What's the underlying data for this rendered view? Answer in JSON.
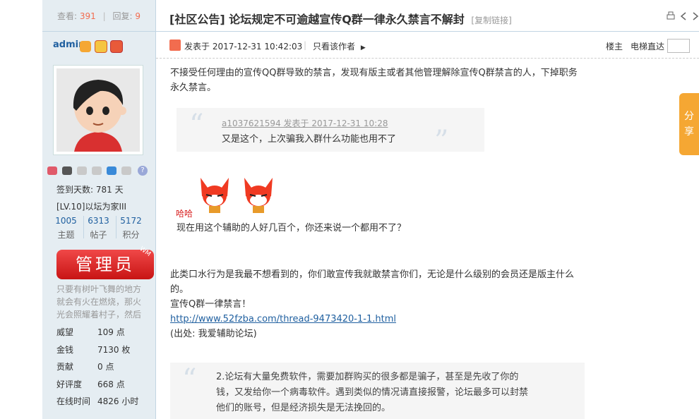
{
  "stats": {
    "views_label": "查看:",
    "views": "391",
    "replies_label": "回复:",
    "replies": "9"
  },
  "title": {
    "text": "[社区公告] 论坛规定不可逾越宣传Q群一律永久禁言不解封",
    "copy_link": "[复制链接]"
  },
  "author": {
    "username": "admin",
    "signin_days": "签到天数: 781 天",
    "level": "[LV.10]以坛为家III",
    "stats": [
      {
        "value": "1005",
        "label": "主题"
      },
      {
        "value": "6313",
        "label": "帖子"
      },
      {
        "value": "5172",
        "label": "积分"
      }
    ],
    "badge": "管理员",
    "badge_corner": "WM",
    "bio": "只要有树叶飞舞的地方就会有火在燃烧，那火光会照耀着村子，然后",
    "details": [
      {
        "label": "威望",
        "value": "109 点"
      },
      {
        "label": "金钱",
        "value": "7130 枚"
      },
      {
        "label": "贡献",
        "value": "0 点"
      },
      {
        "label": "好评度",
        "value": "668 点"
      },
      {
        "label": "在线时间",
        "value": "4826 小时"
      }
    ]
  },
  "meta": {
    "posted": "发表于 2017-12-31 10:42:03",
    "only_author": "只看该作者",
    "floor": "楼主",
    "jump": "电梯直达"
  },
  "post": {
    "intro": "不接受任何理由的宣传QQ群导致的禁言，发现有版主或者其他管理解除宣传Q群禁言的人，下掉职务永久禁言。",
    "quote1_author": "a1037621594 发表于 2017-12-31 10:28",
    "quote1_text": "又是这个，上次骗我入群什么功能也用不了",
    "emoji_label": "哈哈",
    "reply_text": "现在用这个辅助的人好几百个，你还来说一个都用不了？",
    "para2": "此类口水行为是我最不想看到的，你们敢宣传我就敢禁言你们，无论是什么级别的会员还是版主什么的。",
    "para3": "宣传Q群一律禁言！",
    "link": "http://www.52fzba.com/thread-9473420-1-1.html",
    "source": "(出处: 我爱辅助论坛)",
    "quote2_text": "2.论坛有大量免费软件，需要加群购买的很多都是骗子，甚至是先收了你的钱，又发给你一个病毒软件。遇到类似的情况请直接报警，论坛最多可以封禁他们的账号，但是经济损失是无法挽回的。"
  },
  "share": {
    "label": "分享"
  },
  "colors": {
    "accent": "#f26c4f",
    "link": "#2060a0",
    "sidebar": "#e5edf2",
    "share": "#f5a733",
    "badge": "#d81e1e"
  },
  "icons": [
    "print-icon",
    "prev-icon",
    "next-icon",
    "post-author-icon",
    "medal-icon",
    "gem-icon"
  ]
}
